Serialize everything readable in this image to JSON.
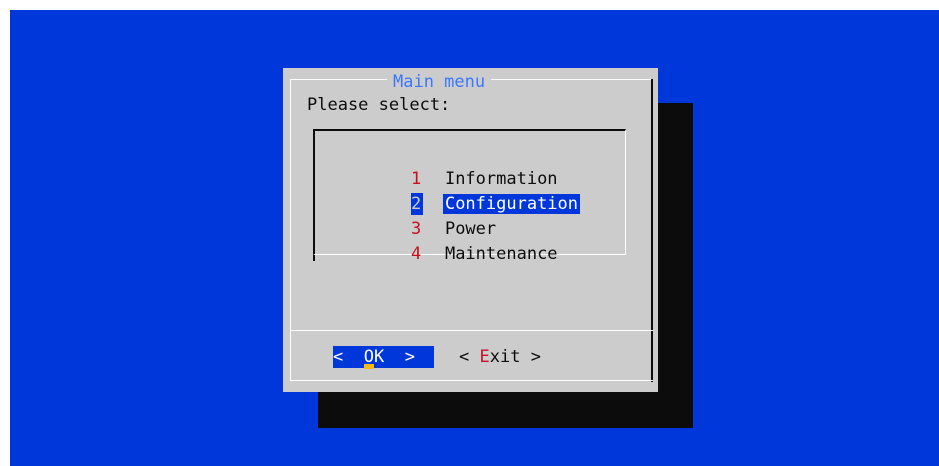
{
  "dialog": {
    "title": "Main menu",
    "prompt": "Please select:"
  },
  "menu": {
    "items": [
      {
        "key": "1",
        "label": "Information",
        "selected": false
      },
      {
        "key": "2",
        "label": "Configuration",
        "selected": true
      },
      {
        "key": "3",
        "label": "Power",
        "selected": false
      },
      {
        "key": "4",
        "label": "Maintenance",
        "selected": false
      }
    ]
  },
  "buttons": {
    "ok": {
      "left_bracket": "<",
      "hotkey": "O",
      "rest": "K",
      "right_bracket": ">"
    },
    "exit": {
      "left_bracket": "<",
      "hotkey": "E",
      "rest": "xit",
      "right_bracket": ">"
    }
  },
  "colors": {
    "background": "#0037da",
    "dialog": "#cccccc",
    "title": "#3b78ff",
    "hotkey": "#c50f1f",
    "selection": "#0037da",
    "shadow": "#0c0c0c"
  }
}
